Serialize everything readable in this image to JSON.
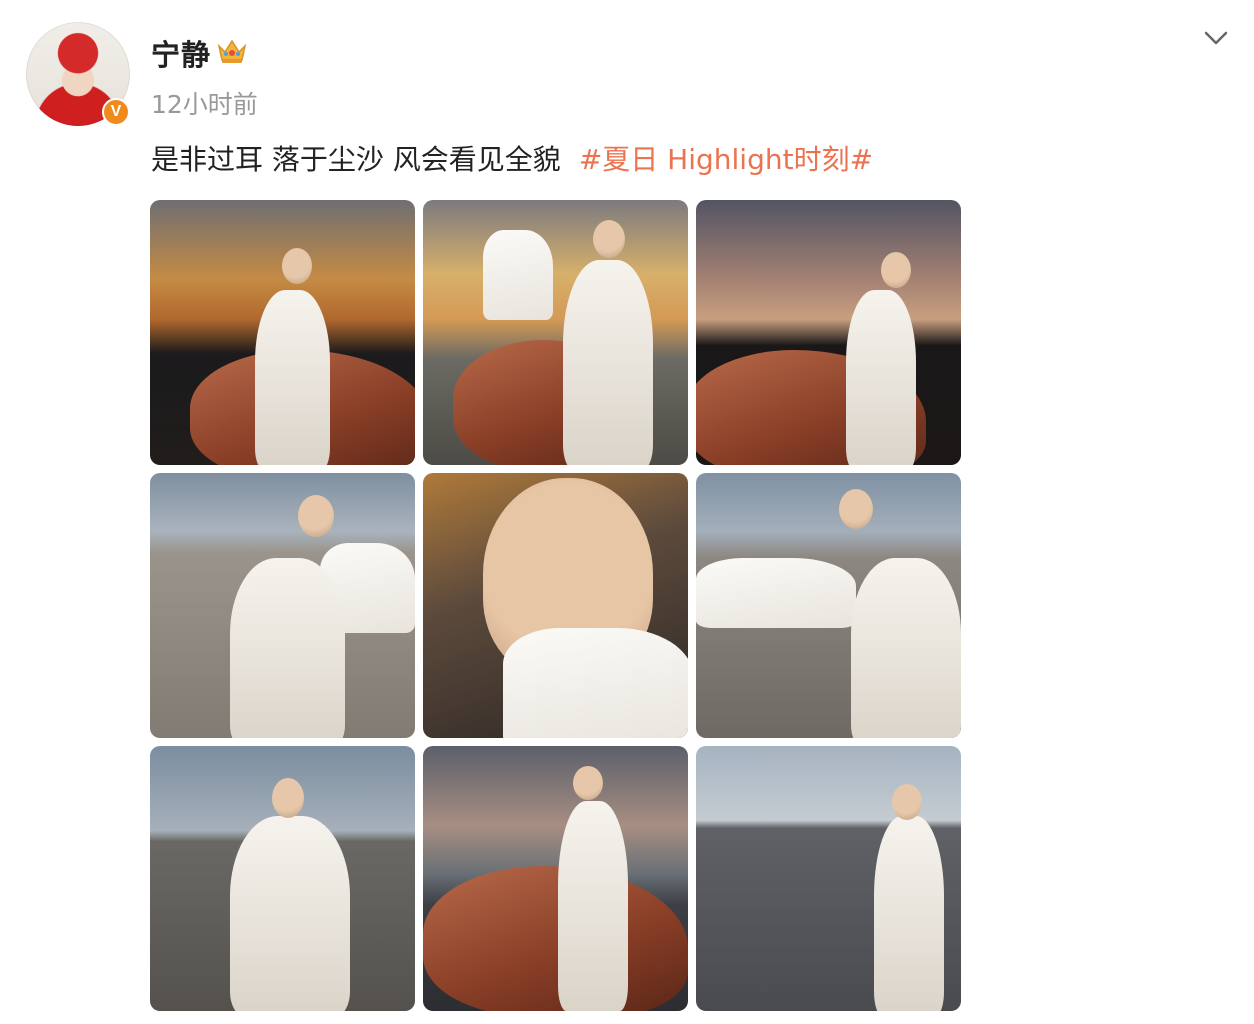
{
  "post": {
    "username": "宁静",
    "timestamp": "12小时前",
    "text": "是非过耳 落于尘沙 风会看见全貌",
    "hashtag": "#夏日 Highlight时刻#",
    "verified_label": "V"
  },
  "icons": {
    "user": "crown-icon",
    "verified": "verified-icon",
    "menu": "chevron-down-icon"
  },
  "colors": {
    "hashtag": "#eb7350",
    "verified_badge": "#f08a1d",
    "timestamp": "#999999"
  },
  "photos": [
    {
      "scene": "sunset-rock"
    },
    {
      "scene": "sunset-sleeve"
    },
    {
      "scene": "dusk-prayer"
    },
    {
      "scene": "gravel-sleeve"
    },
    {
      "scene": "face-closeup"
    },
    {
      "scene": "gravel-arm"
    },
    {
      "scene": "sunglasses-gravel"
    },
    {
      "scene": "rock-dusk"
    },
    {
      "scene": "gravel-standing"
    }
  ]
}
